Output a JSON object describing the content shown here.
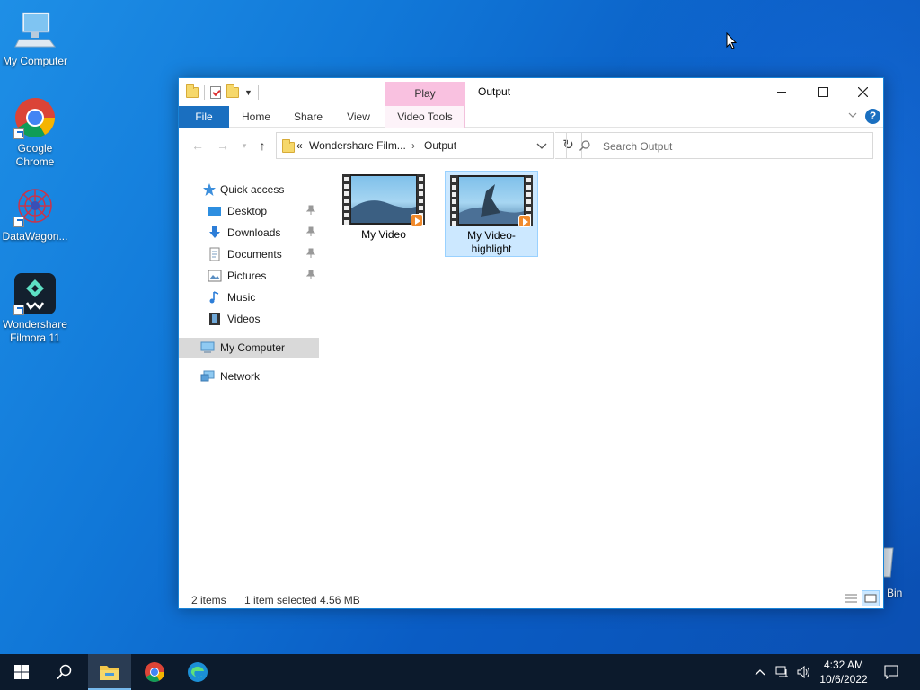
{
  "desktop": {
    "icons": [
      {
        "label": "My Computer"
      },
      {
        "label": "Google Chrome"
      },
      {
        "label": "DataWagon..."
      },
      {
        "label": "Wondershare Filmora 11"
      }
    ],
    "recycle_bin_label": "Bin"
  },
  "window": {
    "title": "Output",
    "context_tab": "Play",
    "ribbon_tabs": [
      "File",
      "Home",
      "Share",
      "View",
      "Video Tools"
    ],
    "help_label": "?",
    "address": {
      "overflow": "«",
      "segments": [
        "Wondershare Film...",
        "Output"
      ]
    },
    "search_placeholder": "Search Output",
    "nav": {
      "quick_access": "Quick access",
      "items": [
        "Desktop",
        "Downloads",
        "Documents",
        "Pictures",
        "Music",
        "Videos"
      ],
      "my_computer": "My Computer",
      "network": "Network"
    },
    "files": [
      {
        "name": "My Video"
      },
      {
        "name": "My Video-highlight"
      }
    ],
    "status": {
      "count": "2 items",
      "selection": "1 item selected  4.56 MB"
    }
  },
  "taskbar": {
    "time": "4:32 AM",
    "date": "10/6/2022"
  },
  "colors": {
    "accent": "#1a6fc0",
    "context_tab": "#f9c1e0",
    "selection": "#cce8ff",
    "taskbar": "#0c1a2c"
  }
}
